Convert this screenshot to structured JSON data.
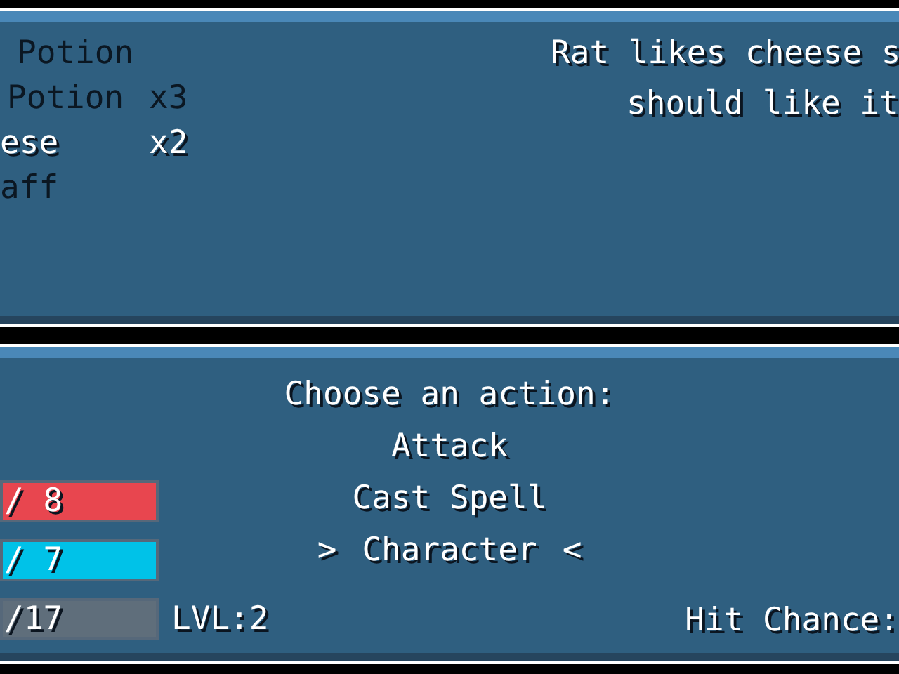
{
  "inventory": {
    "items": [
      {
        "name": "Potion",
        "selected": false
      },
      {
        "name": "Potion",
        "count": "x3",
        "selected": false
      },
      {
        "name": "ese",
        "count": "x2",
        "selected": true
      },
      {
        "name": "aff",
        "selected": false
      }
    ]
  },
  "description": [
    "Rat likes cheese s",
    "should like it"
  ],
  "battle": {
    "prompt": "Choose an action:",
    "actions": [
      {
        "label": "Attack",
        "selected": false
      },
      {
        "label": "Cast Spell",
        "selected": false
      },
      {
        "label": "Character",
        "selected": true
      }
    ],
    "cursor": {
      "left": ">",
      "right": "<"
    },
    "bars": [
      {
        "text": "/ 8",
        "color": "#e8464f",
        "level": 1
      },
      {
        "text": "/ 7",
        "color": "#00c2e8",
        "level": 1
      },
      {
        "text": "/17",
        "color": "#5f6e7b",
        "level": 1
      }
    ],
    "level_label": "LVL:2",
    "hit_chance_label": "Hit Chance:"
  }
}
